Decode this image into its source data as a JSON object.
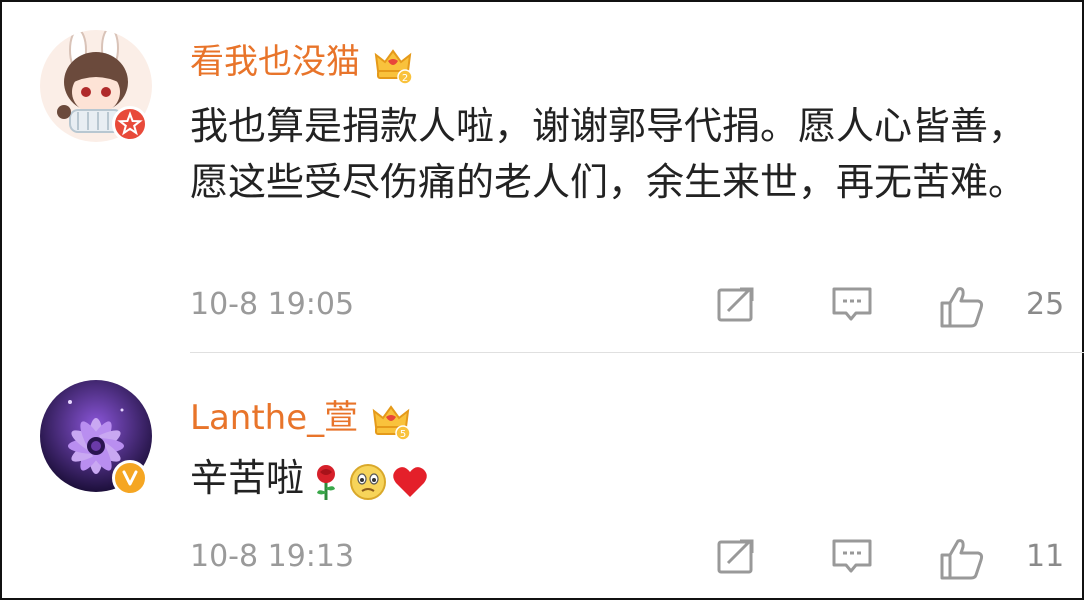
{
  "comments": [
    {
      "username": "看我也没猫",
      "vip_level": "2",
      "text": "我也算是捐款人啦，谢谢郭导代捐。愿人心皆善，愿这些受尽伤痛的老人们，余生来世，再无苦难。",
      "timestamp": "10-8 19:05",
      "likes": "25",
      "avatar_icon": "anime-girl-avatar",
      "badge_icon": "red-star-badge-icon",
      "accent": "#e84a3a"
    },
    {
      "username": "Lanthe_萱",
      "vip_level": "5",
      "text": "辛苦啦",
      "emojis": [
        "rose-emoji",
        "crying-face-emoji",
        "red-heart-emoji"
      ],
      "timestamp": "10-8 19:13",
      "likes": "11",
      "avatar_icon": "purple-flower-avatar",
      "badge_icon": "yellow-v-badge-icon",
      "accent": "#f5a623"
    }
  ],
  "colors": {
    "username": "#e8742a",
    "text": "#222222",
    "meta": "#9a9a9a",
    "icon": "#999999"
  }
}
